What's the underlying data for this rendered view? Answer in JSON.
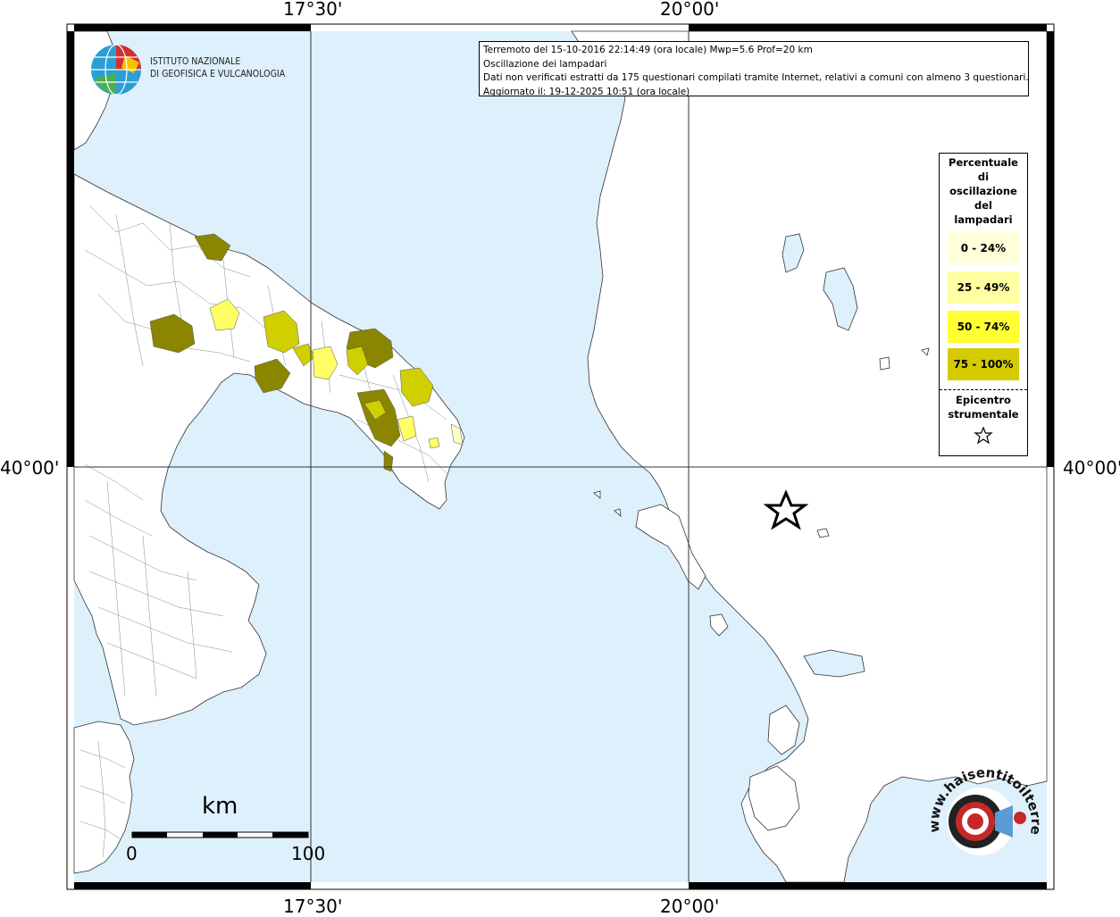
{
  "info": {
    "line1": "Terremoto del 15-10-2016 22:14:49 (ora locale) Mwp=5.6 Prof=20 km",
    "line2": "Oscillazione dei lampadari",
    "line3": "Dati non verificati estratti da 175 questionari compilati tramite Internet, relativi a comuni con almeno 3 questionari.",
    "line4": "Aggiornato il: 19-12-2025 10:51 (ora locale)"
  },
  "coords": {
    "top_left": "17°30'",
    "top_right": "20°00'",
    "bottom_left": "17°30'",
    "bottom_right": "20°00'",
    "lat_left": "40°00'",
    "lat_right": "40°00'"
  },
  "logo": {
    "line1": "ISTITUTO NAZIONALE",
    "line2": "DI GEOFISICA E VULCANOLOGIA"
  },
  "legend": {
    "title_lines": [
      "Percentuale",
      "di",
      "oscillazione",
      "del",
      "lampadari"
    ],
    "classes": [
      {
        "label": "0 - 24%",
        "color": "#FFFFD9"
      },
      {
        "label": "25 - 49%",
        "color": "#FFFFA3"
      },
      {
        "label": "50 - 74%",
        "color": "#FFFF33"
      },
      {
        "label": "75 - 100%",
        "color": "#D4CC00"
      }
    ],
    "epicenter_line1": "Epicentro",
    "epicenter_line2": "strumentale"
  },
  "scalebar": {
    "unit": "km",
    "start": "0",
    "end": "100"
  },
  "colors": {
    "sea": "#DDF0FC",
    "land": "#FFFFFF",
    "class_50_74_map": "#D0CF00",
    "class_75_100_map": "#8A8600"
  },
  "watermark": {
    "text": "www.haisentitoilterremoto.it"
  }
}
